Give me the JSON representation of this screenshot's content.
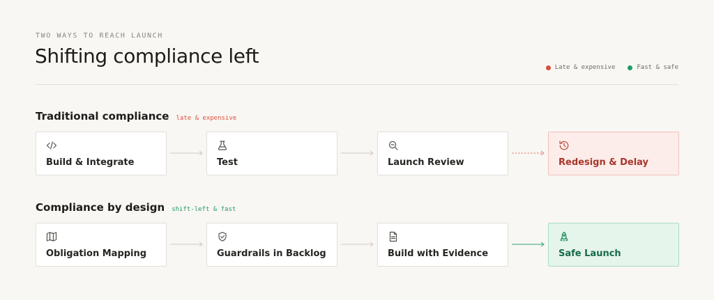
{
  "header": {
    "eyebrow": "TWO WAYS TO REACH LAUNCH",
    "title": "Shifting compliance left"
  },
  "legend": [
    {
      "label": "Late & expensive",
      "color": "#d9503f"
    },
    {
      "label": "Fast & safe",
      "color": "#1f9b64"
    }
  ],
  "traditional": {
    "title": "Traditional compliance",
    "tag": "late & expensive",
    "tag_color": "#d9503f",
    "steps": [
      {
        "label": "Build & Integrate",
        "icon": "code-icon"
      },
      {
        "label": "Test",
        "icon": "flask-icon"
      },
      {
        "label": "Launch Review",
        "icon": "magnifier-icon"
      },
      {
        "label": "Redesign & Delay",
        "icon": "history-icon"
      }
    ]
  },
  "by_design": {
    "title": "Compliance by design",
    "tag": "shift-left & fast",
    "tag_color": "#1f9b64",
    "steps": [
      {
        "label": "Obligation Mapping",
        "icon": "map-icon"
      },
      {
        "label": "Guardrails in Backlog",
        "icon": "shield-check-icon"
      },
      {
        "label": "Build with Evidence",
        "icon": "document-icon"
      },
      {
        "label": "Safe Launch",
        "icon": "rocket-icon"
      }
    ]
  }
}
